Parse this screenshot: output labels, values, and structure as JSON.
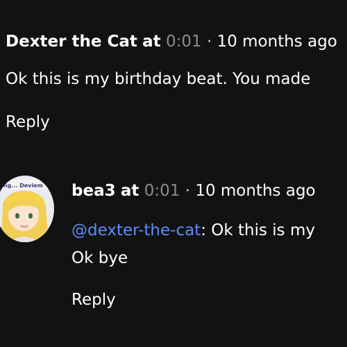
{
  "comments": [
    {
      "author": "Dexter the Cat",
      "at_label": "at",
      "timecode": "0:01",
      "separator": "·",
      "age": "10 months ago",
      "text": "Ok this is my birthday beat. You made",
      "reply_label": "Reply"
    },
    {
      "author": "bea3",
      "at_label": "at",
      "timecode": "0:01",
      "separator": "·",
      "age": "10 months ago",
      "mention": "@dexter-the-cat",
      "text_after_mention": ": Ok this is my",
      "text_line2": "Ok bye",
      "reply_label": "Reply",
      "avatar_banner_text": "ing... Deviem"
    }
  ],
  "colors": {
    "background": "#121212",
    "text": "#ffffff",
    "muted": "#8c8c8c",
    "mention": "#5c8dff"
  },
  "icons": {
    "avatar": "user-avatar-anime-girl"
  }
}
